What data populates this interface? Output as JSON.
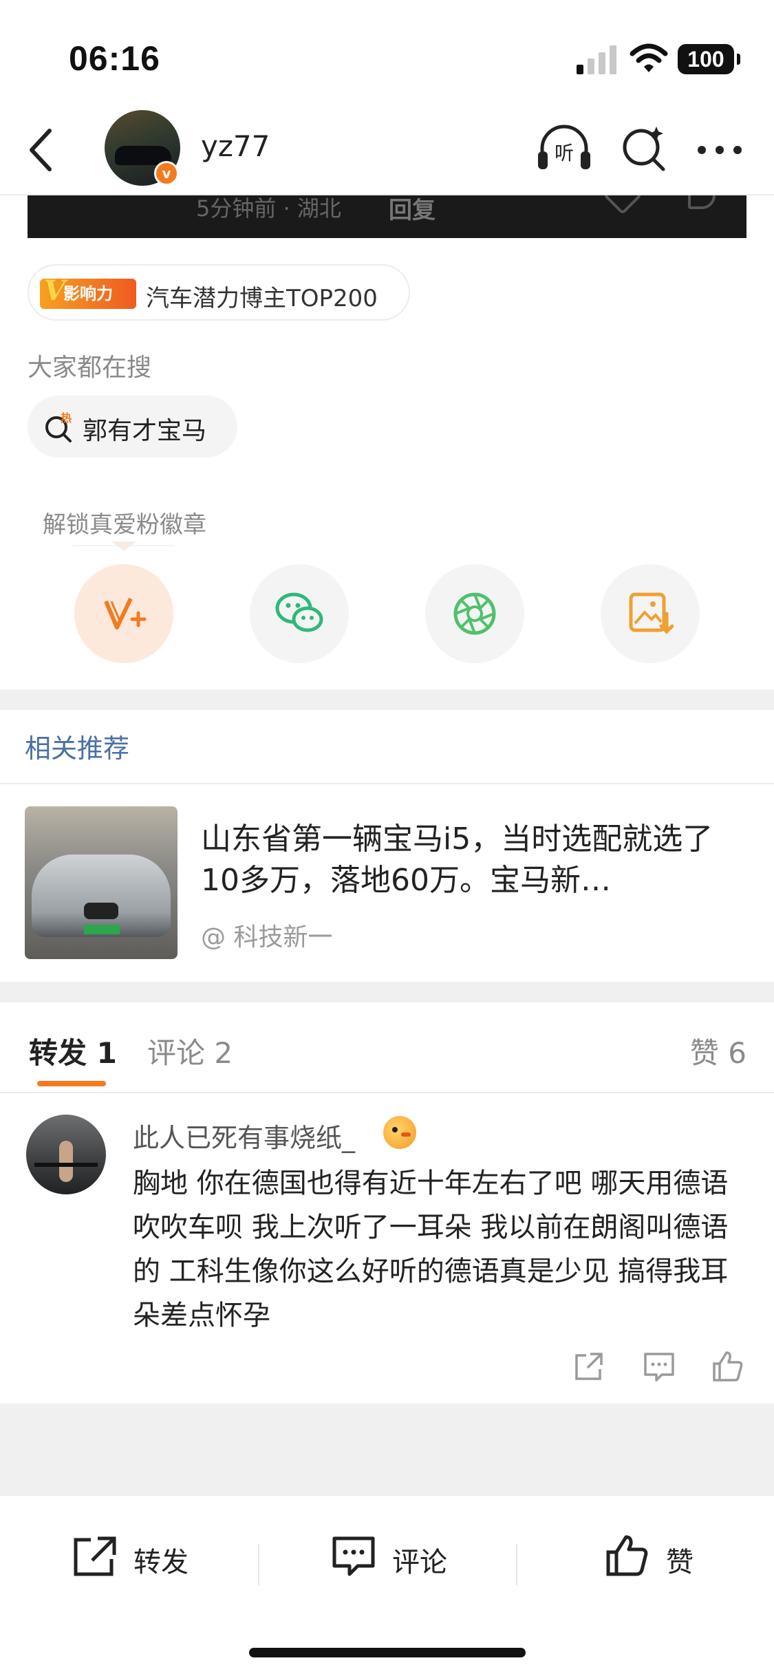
{
  "status_bar": {
    "time": "06:16",
    "battery": "100"
  },
  "navbar": {
    "username": "yz77",
    "icons": [
      "back-icon",
      "listen-icon",
      "search-icon",
      "more-icon"
    ],
    "listen_label": "听"
  },
  "post_strip": {
    "meta": "5分钟前 · 湖北",
    "reply": "回复"
  },
  "influence_badge": {
    "tag": "影响力",
    "text": "汽车潜力博主TOP200",
    "colors": {
      "start": "#f6a11f",
      "end": "#f05a23"
    }
  },
  "search_section": {
    "header": "大家都在搜",
    "hot_tag": "热",
    "chip_label": "郭有才宝马"
  },
  "unlock": {
    "label": "解锁真爱粉徽章",
    "share_icons": [
      "vplus-icon",
      "wechat-icon",
      "moments-icon",
      "save-image-icon"
    ]
  },
  "related": {
    "title": "相关推荐",
    "item": {
      "title": "山东省第一辆宝马i5，当时选配就选了10多万，落地60万。宝马新…",
      "author": "@ 科技新一"
    }
  },
  "tabs": {
    "repost": "转发 1",
    "comment": "评论 2",
    "like": "赞 6",
    "accent": "#f47a1f"
  },
  "repost_item": {
    "name": "此人已死有事烧纸_",
    "text": "胸地 你在德国也得有近十年左右了吧  哪天用德语吹吹车呗  我上次听了一耳朵   我以前在朗阁叫德语的  工科生像你这么好听的德语真是少见 搞得我耳朵差点怀孕"
  },
  "bottom_bar": {
    "repost": "转发",
    "comment": "评论",
    "like": "赞"
  }
}
